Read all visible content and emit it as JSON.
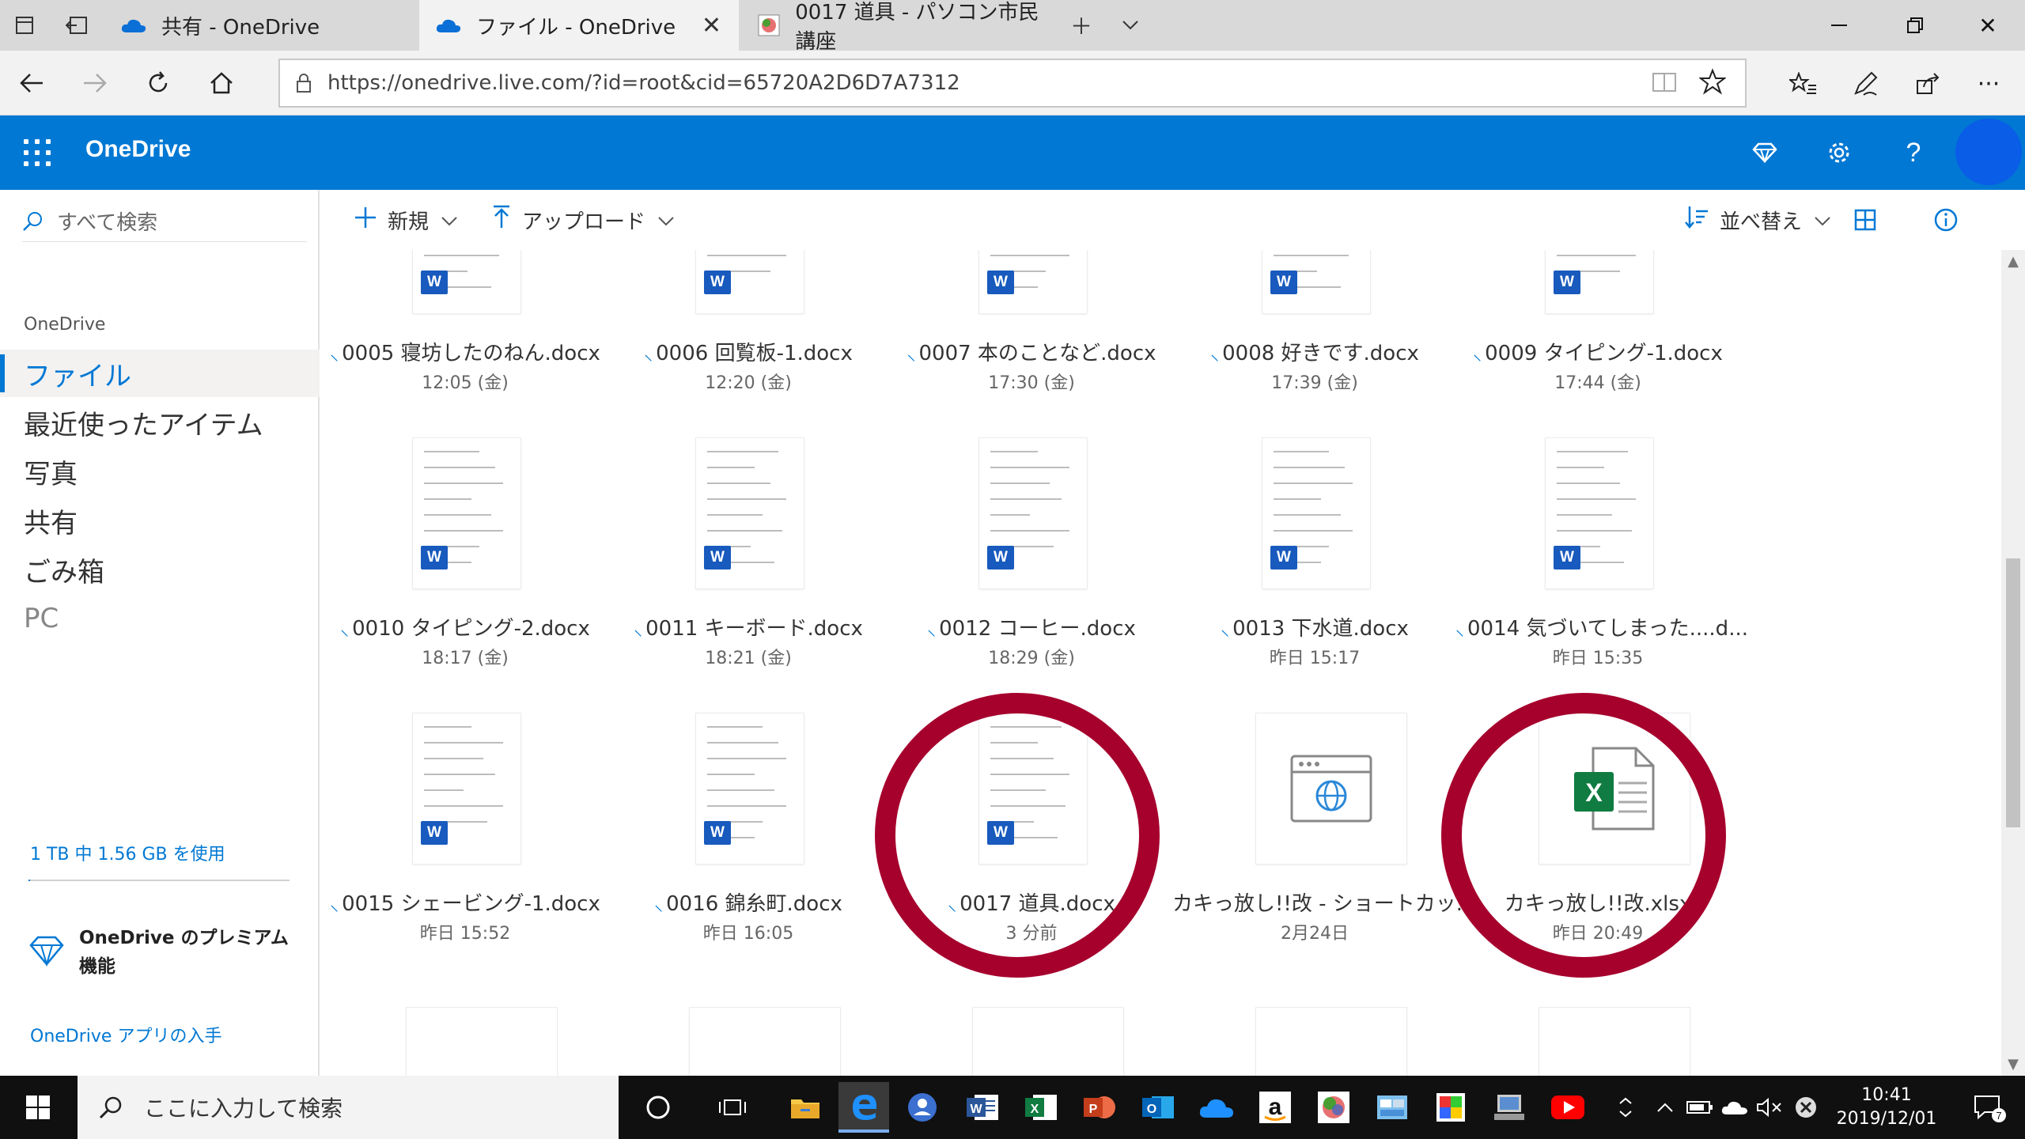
{
  "browser": {
    "tabs": [
      {
        "title": "共有 - OneDrive"
      },
      {
        "title": "ファイル - OneDrive"
      },
      {
        "title": "0017 道具 - パソコン市民講座"
      }
    ],
    "url": "https://onedrive.live.com/?id=root&cid=65720A2D6D7A7312"
  },
  "header": {
    "app_name": "OneDrive"
  },
  "sidebar": {
    "search_placeholder": "すべて検索",
    "section_title": "OneDrive",
    "items": [
      {
        "label": "ファイル",
        "active": true
      },
      {
        "label": "最近使ったアイテム"
      },
      {
        "label": "写真"
      },
      {
        "label": "共有"
      },
      {
        "label": "ごみ箱"
      },
      {
        "label": "PC"
      }
    ],
    "storage_text": "1 TB 中 1.56 GB を使用",
    "storage_used_fraction": 0.0015,
    "premium_text_line1": "OneDrive のプレミアム",
    "premium_text_line2": "機能",
    "get_app": "OneDrive アプリの入手"
  },
  "commandbar": {
    "new_label": "新規",
    "upload_label": "アップロード",
    "sort_label": "並べ替え"
  },
  "files": [
    {
      "name": "0005 寝坊したのねん.docx",
      "date": "12:05 (金)",
      "new": true
    },
    {
      "name": "0006 回覧板-1.docx",
      "date": "12:20 (金)",
      "new": true
    },
    {
      "name": "0007 本のことなど.docx",
      "date": "17:30 (金)",
      "new": true
    },
    {
      "name": "0008 好きです.docx",
      "date": "17:39 (金)",
      "new": true
    },
    {
      "name": "0009 タイピング-1.docx",
      "date": "17:44 (金)",
      "new": true
    },
    {
      "name": "0010 タイピング-2.docx",
      "date": "18:17 (金)",
      "new": true
    },
    {
      "name": "0011 キーボード.docx",
      "date": "18:21 (金)",
      "new": true
    },
    {
      "name": "0012 コーヒー.docx",
      "date": "18:29 (金)",
      "new": true
    },
    {
      "name": "0013 下水道.docx",
      "date": "昨日 15:17",
      "new": true
    },
    {
      "name": "0014 気づいてしまった....d...",
      "date": "昨日 15:35",
      "new": true
    },
    {
      "name": "0015 シェービング-1.docx",
      "date": "昨日 15:52",
      "new": true
    },
    {
      "name": "0016 錦糸町.docx",
      "date": "昨日 16:05",
      "new": true
    },
    {
      "name": "0017 道具.docx",
      "date": "3 分前",
      "new": true
    },
    {
      "name": "カキっ放し!!改 - ショートカッ...",
      "date": "2月24日"
    },
    {
      "name": "カキっ放し!!改.xlsx",
      "date": "昨日 20:49"
    }
  ],
  "taskbar": {
    "search_placeholder": "ここに入力して検索",
    "time": "10:41",
    "date": "2019/12/01",
    "notification_count": "7"
  },
  "colors": {
    "accent": "#0078d4",
    "highlight_circle": "#a6002d",
    "word": "#185abd",
    "excel": "#107c41"
  }
}
